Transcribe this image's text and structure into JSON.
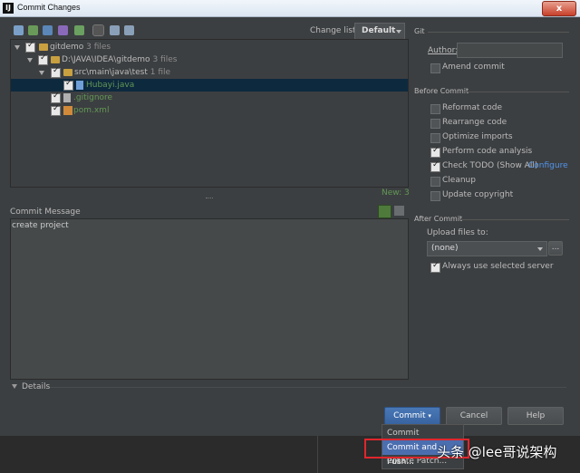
{
  "window": {
    "title": "Commit Changes",
    "logo": "IJ",
    "close": "x"
  },
  "toolbar": {
    "icons": [
      "refresh-icon",
      "move-icon",
      "diff-icon",
      "rollback-icon",
      "jump-icon",
      "group-icon",
      "expand-icon",
      "collapse-icon"
    ],
    "changelist_label": "Change list:",
    "changelist_value": "Default"
  },
  "tree": {
    "rows": [
      {
        "name": "gitdemo",
        "count": "3 files"
      },
      {
        "name": "D:\\JAVA\\IDEA\\gitdemo",
        "count": "3 files"
      },
      {
        "name": "src\\main\\java\\test",
        "count": "1 file"
      },
      {
        "name": "Hubayi.java",
        "count": ""
      },
      {
        "name": ".gitignore",
        "count": ""
      },
      {
        "name": "pom.xml",
        "count": ""
      }
    ],
    "status": "New: 3"
  },
  "commit_message": {
    "label": "Commit Message",
    "text": "create project"
  },
  "details_label": "Details",
  "git": {
    "section": "Git",
    "author_label": "Author:",
    "author_value": "",
    "amend": "Amend commit"
  },
  "before_commit": {
    "section": "Before Commit",
    "options": [
      {
        "label": "Reformat code",
        "checked": false
      },
      {
        "label": "Rearrange code",
        "checked": false
      },
      {
        "label": "Optimize imports",
        "checked": false
      },
      {
        "label": "Perform code analysis",
        "checked": true
      },
      {
        "label": "Check TODO (Show All)",
        "checked": true
      },
      {
        "label": "Cleanup",
        "checked": false
      },
      {
        "label": "Update copyright",
        "checked": false
      }
    ],
    "configure": "Configure"
  },
  "after_commit": {
    "section": "After Commit",
    "upload_label": "Upload files to:",
    "upload_value": "(none)",
    "browse": "...",
    "always_use": "Always use selected server"
  },
  "buttons": {
    "commit": "Commit",
    "cancel": "Cancel",
    "help": "Help"
  },
  "menu": {
    "items": [
      "Commit",
      "Commit and Push...",
      "Create Patch..."
    ]
  },
  "watermark": "头条 @lee哥说架构",
  "colors": {
    "background": "#3c3f41",
    "selection": "#0d293e",
    "accent": "#4b6eaf",
    "highlight_box": "#e0262d"
  }
}
